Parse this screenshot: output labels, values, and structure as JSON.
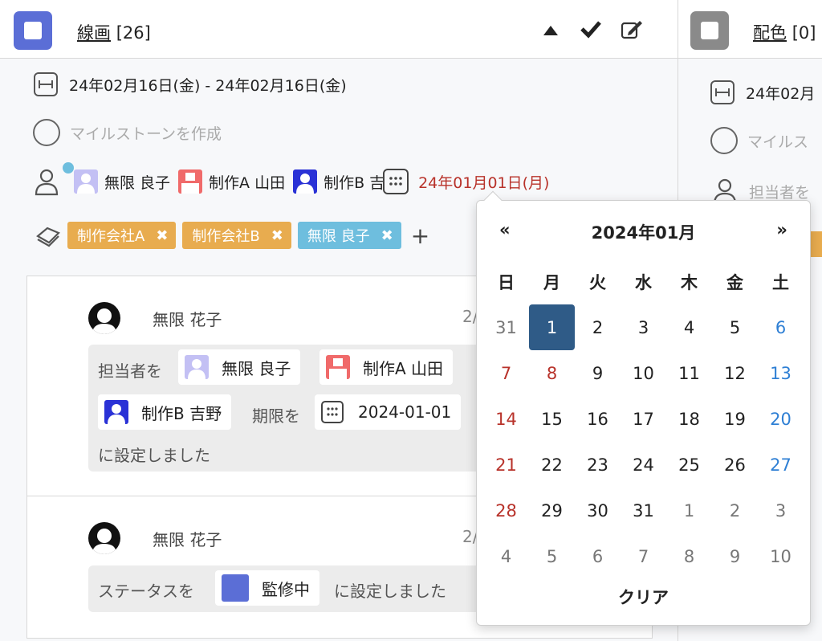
{
  "colors": {
    "status_purple": "#5b6ed6",
    "status_gray": "#8a8a8a",
    "tag_orange": "#e8ac4f",
    "tag_blue": "#6ebede",
    "red": "#b8322a",
    "blue": "#2e7fd4",
    "selected": "#2f5b87",
    "dot": "#6ebede"
  },
  "col1": {
    "title": "線画",
    "count": "[26]",
    "date_range": "24年02月16日(金) - 24年02月16日(金)",
    "milestone_placeholder": "マイルストーンを作成",
    "assignees": [
      {
        "name": "無限 良子",
        "avatar_color": "#c3c0f4"
      },
      {
        "name": "制作A 山田",
        "avatar_color": "#f06a6a"
      },
      {
        "name": "制作B 吉",
        "avatar_color": "#2a32d6"
      }
    ],
    "due_date": "24年01月01日(月)",
    "tags": [
      {
        "label": "制作会社A",
        "color": "#e8ac4f"
      },
      {
        "label": "制作会社B",
        "color": "#e8ac4f"
      },
      {
        "label": "無限 良子",
        "color": "#6ebede"
      }
    ],
    "add_tag": "+",
    "activities": [
      {
        "user": "無限 花子",
        "time": "2/",
        "prefix": "担当者を",
        "assignees": [
          {
            "name": "無限 良子",
            "avatar_color": "#c3c0f4"
          },
          {
            "name": "制作A 山田",
            "avatar_color": "#f06a6a"
          },
          {
            "name": "制作B 吉野",
            "avatar_color": "#2a32d6"
          }
        ],
        "middle": "期限を",
        "date": "2024-01-01",
        "suffix": "に設定しました"
      },
      {
        "user": "無限 花子",
        "time": "2/",
        "prefix": "ステータスを",
        "status": "監修中",
        "status_color": "#5b6ed6",
        "suffix": "に設定しました"
      }
    ]
  },
  "col2": {
    "title": "配色",
    "count": "[0]",
    "date_partial": "24年02月",
    "milestone_partial": "マイルス",
    "assignee_partial": "担当者を"
  },
  "datepicker": {
    "prev": "«",
    "next": "»",
    "title": "2024年01月",
    "weekdays": [
      "日",
      "月",
      "火",
      "水",
      "木",
      "金",
      "土"
    ],
    "days": [
      [
        "31",
        "1",
        "2",
        "3",
        "4",
        "5",
        "6"
      ],
      [
        "7",
        "8",
        "9",
        "10",
        "11",
        "12",
        "13"
      ],
      [
        "14",
        "15",
        "16",
        "17",
        "18",
        "19",
        "20"
      ],
      [
        "21",
        "22",
        "23",
        "24",
        "25",
        "26",
        "27"
      ],
      [
        "28",
        "29",
        "30",
        "31",
        "1",
        "2",
        "3"
      ],
      [
        "4",
        "5",
        "6",
        "7",
        "8",
        "9",
        "10"
      ]
    ],
    "selected_day": "1",
    "clear": "クリア"
  }
}
